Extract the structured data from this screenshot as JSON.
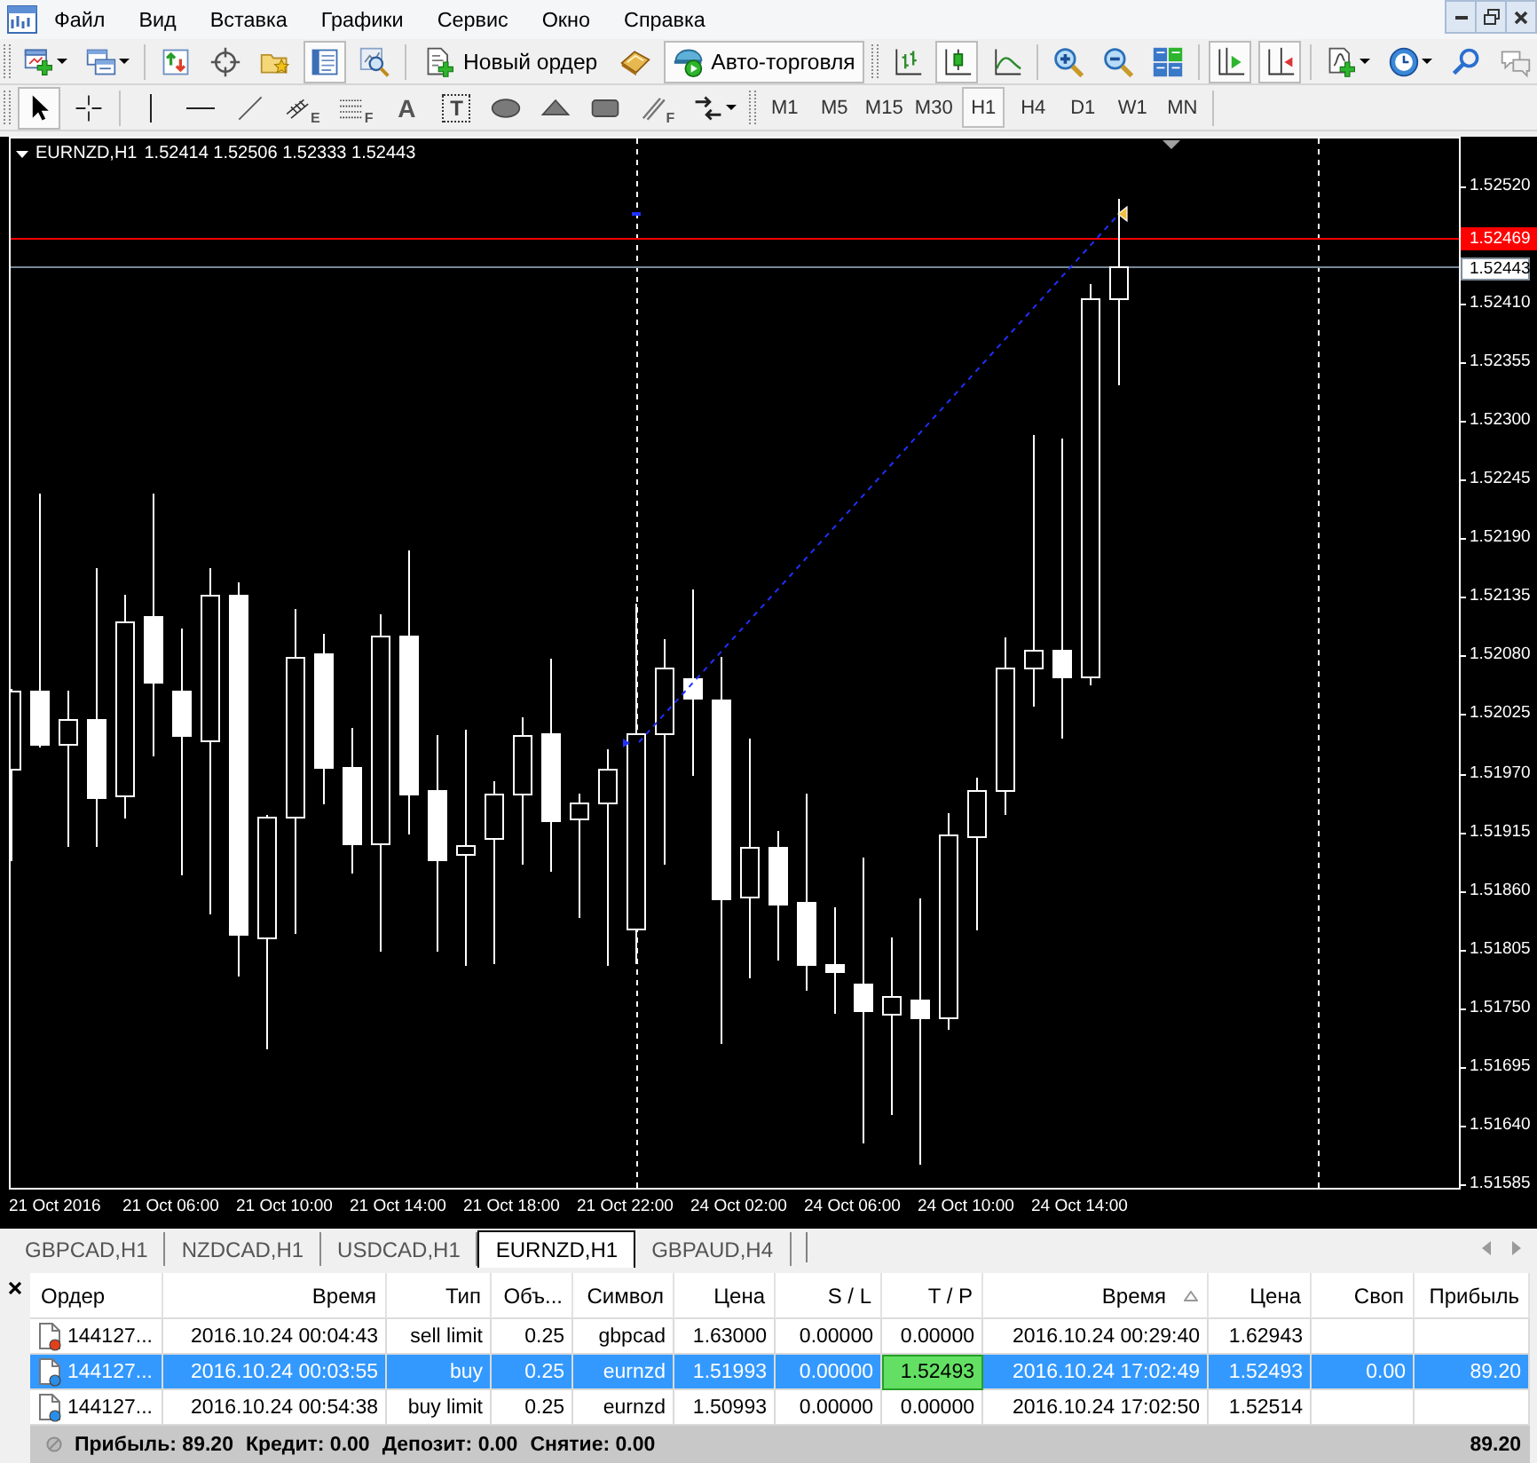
{
  "menu": [
    "Файл",
    "Вид",
    "Вставка",
    "Графики",
    "Сервис",
    "Окно",
    "Справка"
  ],
  "main_toolbar": {
    "groups": [
      [
        {
          "kind": "new-chart",
          "pressed": false,
          "dropdown": true
        },
        {
          "kind": "profiles",
          "pressed": false,
          "dropdown": true
        }
      ],
      [
        {
          "kind": "market-watch",
          "pressed": false
        },
        {
          "kind": "data-window",
          "pressed": false
        },
        {
          "kind": "navigator",
          "pressed": false
        },
        {
          "kind": "terminal",
          "pressed": true
        },
        {
          "kind": "tester",
          "pressed": false
        }
      ],
      [
        {
          "kind": "new-order",
          "label": "Новый ордер",
          "pressed": false
        },
        {
          "kind": "editor",
          "pressed": false
        },
        {
          "kind": "autotrading",
          "label": "Авто-торговля",
          "pressed": true
        }
      ]
    ]
  },
  "chart_toolbar": {
    "groups": [
      [
        {
          "kind": "bar-chart",
          "pressed": false
        },
        {
          "kind": "candle-chart",
          "pressed": true
        },
        {
          "kind": "line-chart",
          "pressed": false
        }
      ],
      [
        {
          "kind": "zoom-in",
          "pressed": false
        },
        {
          "kind": "zoom-out",
          "pressed": false
        },
        {
          "kind": "tile",
          "pressed": false
        }
      ],
      [
        {
          "kind": "auto-scroll",
          "pressed": true
        },
        {
          "kind": "chart-shift",
          "pressed": true
        }
      ],
      [
        {
          "kind": "indicators",
          "pressed": false,
          "dropdown": true
        },
        {
          "kind": "periods",
          "pressed": false,
          "dropdown": true
        },
        {
          "kind": "search",
          "pressed": false
        },
        {
          "kind": "chat",
          "pressed": false
        }
      ]
    ]
  },
  "drawing_toolbar": {
    "groups": [
      [
        {
          "kind": "cursor",
          "pressed": true
        },
        {
          "kind": "crosshair",
          "pressed": false
        }
      ],
      [
        {
          "kind": "vertical-line",
          "pressed": false
        },
        {
          "kind": "horizontal-line",
          "pressed": false
        },
        {
          "kind": "trendline",
          "pressed": false
        },
        {
          "kind": "channel",
          "glyph": "E",
          "pressed": false
        },
        {
          "kind": "fibonacci",
          "glyph": "F",
          "pressed": false
        },
        {
          "kind": "text",
          "glyph": "A",
          "pressed": false
        },
        {
          "kind": "text-label",
          "glyph": "T",
          "pressed": false
        },
        {
          "kind": "ellipse",
          "pressed": false
        },
        {
          "kind": "triangle",
          "pressed": false
        },
        {
          "kind": "rectangle",
          "pressed": false
        },
        {
          "kind": "fibo-fan",
          "glyph": "F",
          "pressed": false
        },
        {
          "kind": "arrows",
          "pressed": false,
          "dropdown": true
        }
      ]
    ]
  },
  "timeframes": [
    {
      "label": "M1",
      "selected": false
    },
    {
      "label": "M5",
      "selected": false
    },
    {
      "label": "M15",
      "selected": false
    },
    {
      "label": "M30",
      "selected": false
    },
    {
      "label": "H1",
      "selected": true
    },
    {
      "label": "H4",
      "selected": false
    },
    {
      "label": "D1",
      "selected": false
    },
    {
      "label": "W1",
      "selected": false
    },
    {
      "label": "MN",
      "selected": false
    }
  ],
  "chart": {
    "title": "EURNZD,H1",
    "quote": "1.52414 1.52506 1.52333 1.52443",
    "price_labels": [
      "1.52520",
      "1.52410",
      "1.52355",
      "1.52300",
      "1.52245",
      "1.52190",
      "1.52135",
      "1.52080",
      "1.52025",
      "1.51970",
      "1.51915",
      "1.51860",
      "1.51805",
      "1.51750",
      "1.51695",
      "1.51640",
      "1.51585"
    ],
    "price_markers": [
      {
        "kind": "ask",
        "label": "1.52469"
      },
      {
        "kind": "bid",
        "label": "1.52443"
      }
    ],
    "time_labels": [
      "21 Oct 2016",
      "21 Oct 06:00",
      "21 Oct 10:00",
      "21 Oct 14:00",
      "21 Oct 18:00",
      "21 Oct 22:00",
      "24 Oct 02:00",
      "24 Oct 06:00",
      "24 Oct 10:00",
      "24 Oct 14:00"
    ]
  },
  "tabs": [
    {
      "label": "GBPCAD,H1",
      "selected": false
    },
    {
      "label": "NZDCAD,H1",
      "selected": false
    },
    {
      "label": "USDCAD,H1",
      "selected": false
    },
    {
      "label": "EURNZD,H1",
      "selected": true
    },
    {
      "label": "GBPAUD,H4",
      "selected": false
    }
  ],
  "terminal": {
    "columns": [
      {
        "label": "Ордер",
        "sorted": false
      },
      {
        "label": "Время",
        "sorted": false
      },
      {
        "label": "Тип",
        "sorted": false
      },
      {
        "label": "Объ...",
        "sorted": false
      },
      {
        "label": "Символ",
        "sorted": false
      },
      {
        "label": "Цена",
        "sorted": false
      },
      {
        "label": "S / L",
        "sorted": false
      },
      {
        "label": "T / P",
        "sorted": false
      },
      {
        "label": "Время",
        "sorted": true
      },
      {
        "label": "Цена",
        "sorted": false
      },
      {
        "label": "Своп",
        "sorted": false
      },
      {
        "label": "Прибыль",
        "sorted": false
      }
    ],
    "rows": [
      {
        "kind": "sell",
        "selected": false,
        "tp_hit": false,
        "order": "144127...",
        "open_time": "2016.10.24 00:04:43",
        "type": "sell limit",
        "volume": "0.25",
        "symbol": "gbpcad",
        "open_price": "1.63000",
        "sl": "0.00000",
        "tp": "0.00000",
        "close_time": "2016.10.24 00:29:40",
        "price": "1.62943"
      },
      {
        "kind": "buy",
        "selected": true,
        "tp_hit": true,
        "order": "144127...",
        "open_time": "2016.10.24 00:03:55",
        "type": "buy",
        "volume": "0.25",
        "symbol": "eurnzd",
        "open_price": "1.51993",
        "sl": "0.00000",
        "tp": "1.52493",
        "close_time": "2016.10.24 17:02:49",
        "price": "1.52493",
        "swap": "0.00",
        "profit": "89.20"
      },
      {
        "kind": "buy",
        "selected": false,
        "tp_hit": false,
        "order": "144127...",
        "open_time": "2016.10.24 00:54:38",
        "type": "buy limit",
        "volume": "0.25",
        "symbol": "eurnzd",
        "open_price": "1.50993",
        "sl": "0.00000",
        "tp": "0.00000",
        "close_time": "2016.10.24 17:02:50",
        "price": "1.52514"
      }
    ],
    "summary": {
      "items": [
        "Прибыль: 89.20",
        "Кредит: 0.00",
        "Депозит: 0.00",
        "Снятие: 0.00"
      ],
      "total": "89.20"
    }
  }
}
